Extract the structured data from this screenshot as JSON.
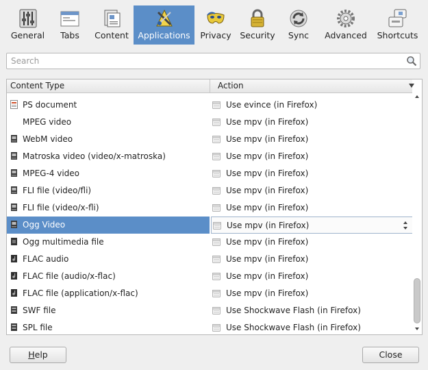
{
  "toolbar": {
    "items": [
      {
        "label": "General",
        "icon": "sliders-icon",
        "active": false
      },
      {
        "label": "Tabs",
        "icon": "tabs-window-icon",
        "active": false
      },
      {
        "label": "Content",
        "icon": "content-documents-icon",
        "active": false
      },
      {
        "label": "Applications",
        "icon": "applications-tools-icon",
        "active": true
      },
      {
        "label": "Privacy",
        "icon": "privacy-mask-icon",
        "active": false
      },
      {
        "label": "Security",
        "icon": "padlock-icon",
        "active": false
      },
      {
        "label": "Sync",
        "icon": "sync-arrows-icon",
        "active": false
      },
      {
        "label": "Advanced",
        "icon": "gear-icon",
        "active": false
      },
      {
        "label": "Shortcuts",
        "icon": "keyboard-keys-icon",
        "active": false
      }
    ]
  },
  "search": {
    "placeholder": "Search",
    "value": ""
  },
  "table": {
    "columns": [
      "Content Type",
      "Action"
    ],
    "rows": [
      {
        "type": "PS document",
        "action": "Use evince (in Firefox)",
        "icon": "ps-document-icon",
        "selected": false
      },
      {
        "type": "MPEG video",
        "action": "Use mpv (in Firefox)",
        "icon": "blank-file-icon",
        "selected": false
      },
      {
        "type": "WebM video",
        "action": "Use mpv (in Firefox)",
        "icon": "video-file-icon",
        "selected": false
      },
      {
        "type": "Matroska video (video/x-matroska)",
        "action": "Use mpv (in Firefox)",
        "icon": "video-file-icon",
        "selected": false
      },
      {
        "type": "MPEG-4 video",
        "action": "Use mpv (in Firefox)",
        "icon": "video-file-icon",
        "selected": false
      },
      {
        "type": "FLI file (video/fli)",
        "action": "Use mpv (in Firefox)",
        "icon": "video-file-icon",
        "selected": false
      },
      {
        "type": "FLI file (video/x-fli)",
        "action": "Use mpv (in Firefox)",
        "icon": "video-file-icon",
        "selected": false
      },
      {
        "type": "Ogg Video",
        "action": "Use mpv (in Firefox)",
        "icon": "video-file-icon",
        "selected": true
      },
      {
        "type": "Ogg multimedia file",
        "action": "Use mpv (in Firefox)",
        "icon": "media-file-icon",
        "selected": false
      },
      {
        "type": "FLAC audio",
        "action": "Use mpv (in Firefox)",
        "icon": "audio-file-icon",
        "selected": false
      },
      {
        "type": "FLAC file (audio/x-flac)",
        "action": "Use mpv (in Firefox)",
        "icon": "audio-file-icon",
        "selected": false
      },
      {
        "type": "FLAC file (application/x-flac)",
        "action": "Use mpv (in Firefox)",
        "icon": "audio-file-icon",
        "selected": false
      },
      {
        "type": "SWF file",
        "action": "Use Shockwave Flash (in Firefox)",
        "icon": "flash-file-icon",
        "selected": false
      },
      {
        "type": "SPL file",
        "action": "Use Shockwave Flash (in Firefox)",
        "icon": "flash-file-icon",
        "selected": false
      }
    ]
  },
  "buttons": {
    "help_mnemonic": "H",
    "help_rest": "elp",
    "close_label": "Close"
  },
  "colors": {
    "selection": "#5b8ec8",
    "window_bg": "#efefef"
  }
}
